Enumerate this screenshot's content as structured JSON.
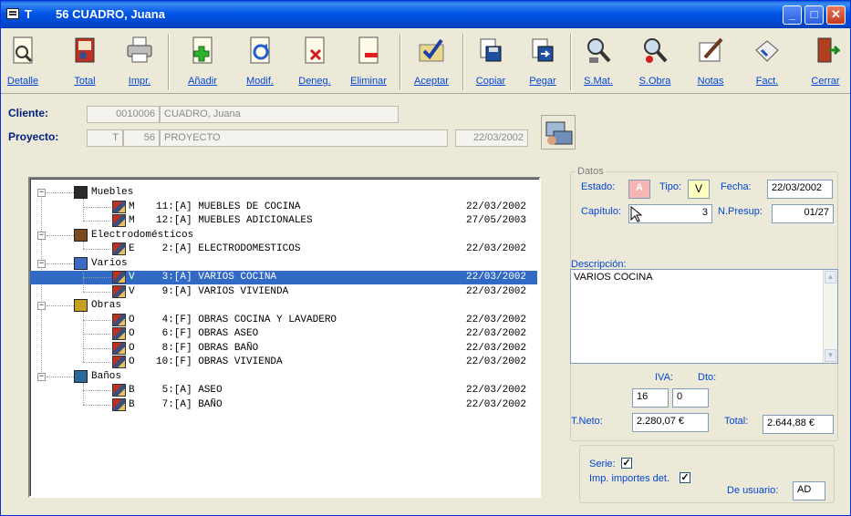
{
  "window": {
    "title_code": "T",
    "title_text": "56  CUADRO, Juana"
  },
  "caption_buttons": {
    "minimize": "_",
    "maximize": "□",
    "close": "✕"
  },
  "toolbar": {
    "detalle": "Detalle",
    "total": "Total",
    "impr": "Impr.",
    "anadir": "Añadir",
    "modif": "Modif.",
    "deneg": "Deneg.",
    "eliminar": "Eliminar",
    "aceptar": "Aceptar",
    "copiar": "Copiar",
    "pegar": "Pegar",
    "smat": "S.Mat.",
    "sobra": "S.Obra",
    "notas": "Notas",
    "fact": "Fact.",
    "cerrar": "Cerrar"
  },
  "header": {
    "cliente_label": "Cliente:",
    "cliente_code": "0010006",
    "cliente_name": "CUADRO, Juana",
    "proyecto_label": "Proyecto:",
    "proyecto_series": "T",
    "proyecto_num": "56",
    "proyecto_name": "PROYECTO",
    "proyecto_date": "22/03/2002"
  },
  "tree": {
    "groups": [
      {
        "name": "Muebles",
        "items": [
          {
            "letter": "M",
            "text": "11:[A] MUEBLES DE COCINA",
            "date": "22/03/2002"
          },
          {
            "letter": "M",
            "text": "12:[A] MUEBLES ADICIONALES",
            "date": "27/05/2003"
          }
        ]
      },
      {
        "name": "Electrodomésticos",
        "items": [
          {
            "letter": "E",
            "text": " 2:[A] ELECTRODOMESTICOS",
            "date": "22/03/2002"
          }
        ]
      },
      {
        "name": "Varios",
        "items": [
          {
            "letter": "V",
            "text": " 3:[A] VARIOS COCINA",
            "date": "22/03/2002",
            "selected": true
          },
          {
            "letter": "V",
            "text": " 9:[A] VARIOS VIVIENDA",
            "date": "22/03/2002"
          }
        ]
      },
      {
        "name": "Obras",
        "items": [
          {
            "letter": "O",
            "text": " 4:[F] OBRAS COCINA Y LAVADERO",
            "date": "22/03/2002"
          },
          {
            "letter": "O",
            "text": " 6:[F] OBRAS ASEO",
            "date": "22/03/2002"
          },
          {
            "letter": "O",
            "text": " 8:[F] OBRAS BAÑO",
            "date": "22/03/2002"
          },
          {
            "letter": "O",
            "text": "10:[F] OBRAS VIVIENDA",
            "date": "22/03/2002"
          }
        ]
      },
      {
        "name": "Baños",
        "items": [
          {
            "letter": "B",
            "text": " 5:[A] ASEO",
            "date": "22/03/2002"
          },
          {
            "letter": "B",
            "text": " 7:[A] BAÑO",
            "date": "22/03/2002"
          }
        ]
      }
    ]
  },
  "datos": {
    "group_label": "Datos",
    "estado_label": "Estado:",
    "estado_value": "A",
    "tipo_label": "Tipo:",
    "tipo_value": "V",
    "fecha_label": "Fecha:",
    "fecha_value": "22/03/2002",
    "capitulo_label": "Capítulo:",
    "capitulo_value": "3",
    "npresup_label": "N.Presup:",
    "npresup_value": "01/27",
    "descripcion_label": "Descripción:",
    "descripcion_value": "VARIOS COCINA",
    "iva_label": "IVA:",
    "iva_value": "16",
    "dto_label": "Dto:",
    "dto_value": "0",
    "tneto_label": "T.Neto:",
    "tneto_value": "2.280,07 €",
    "total_label": "Total:",
    "total_value": "2.644,88 €",
    "serie_label": "Serie:",
    "serie_checked": true,
    "imp_label": "Imp. importes det.",
    "imp_checked": true,
    "usuario_label": "De usuario:",
    "usuario_value": "AD"
  },
  "colors": {
    "selection": "#316ac5",
    "label_blue": "#0046d5",
    "estado_bg": "#f7b5b5",
    "tipo_bg": "#ffffc0"
  }
}
